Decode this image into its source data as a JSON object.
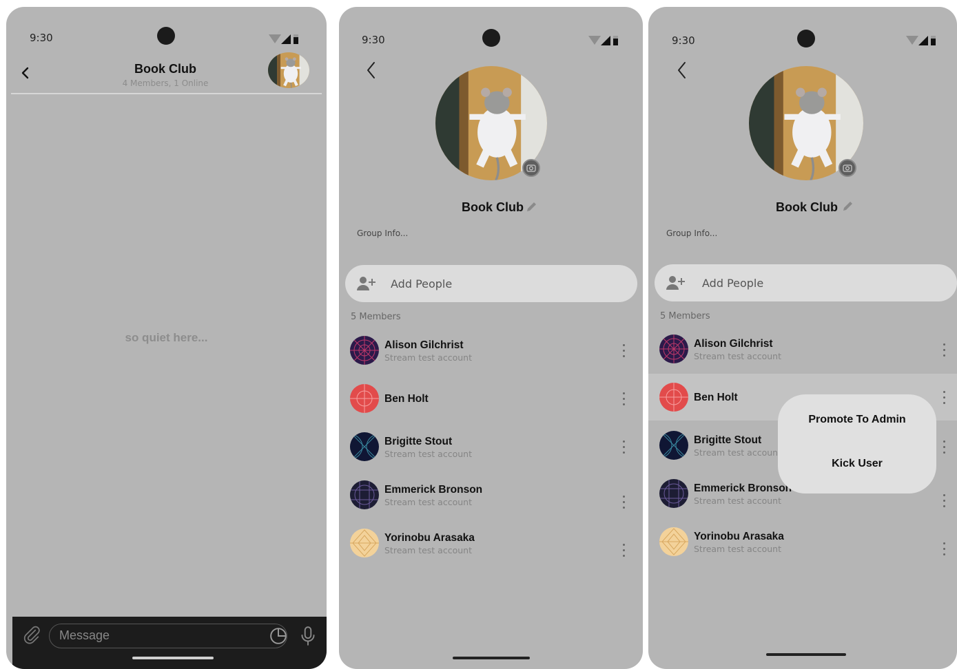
{
  "status_time": "9:30",
  "chat": {
    "title": "Book Club",
    "subtitle": "4 Members, 1 Online",
    "empty_text": "so quiet here...",
    "message_placeholder": "Message"
  },
  "group": {
    "name": "Book Club",
    "info": "Group Info...",
    "add_people_label": "Add People",
    "members_count": "5 Members",
    "members": [
      {
        "name": "Alison Gilchrist",
        "subtitle": "Stream test account"
      },
      {
        "name": "Ben Holt",
        "subtitle": ""
      },
      {
        "name": "Brigitte Stout",
        "subtitle": "Stream test account"
      },
      {
        "name": "Emmerick Bronson",
        "subtitle": "Stream test account"
      },
      {
        "name": "Yorinobu Arasaka",
        "subtitle": "Stream test account"
      }
    ]
  },
  "context_menu": {
    "promote_label": "Promote To Admin",
    "kick_label": "Kick User"
  },
  "colors": {
    "screen_bg": "#b5b5b5",
    "composer_bg": "#1c1c1c",
    "add_people_bg": "#dcdcdc",
    "menu_bg": "#e0e0e0",
    "avatar_alison": "#2c1a4a",
    "avatar_ben": "#e24b4b",
    "avatar_brigitte": "#101634",
    "avatar_emmerick": "#1d1d34",
    "avatar_yorinobu": "#f3d29a"
  },
  "icons": [
    "back-arrow-icon",
    "camera-icon",
    "edit-pencil-icon",
    "add-person-icon",
    "kebab-menu-icon",
    "attachment-icon",
    "sticker-icon",
    "microphone-icon",
    "wifi-icon",
    "signal-icon",
    "battery-icon"
  ]
}
